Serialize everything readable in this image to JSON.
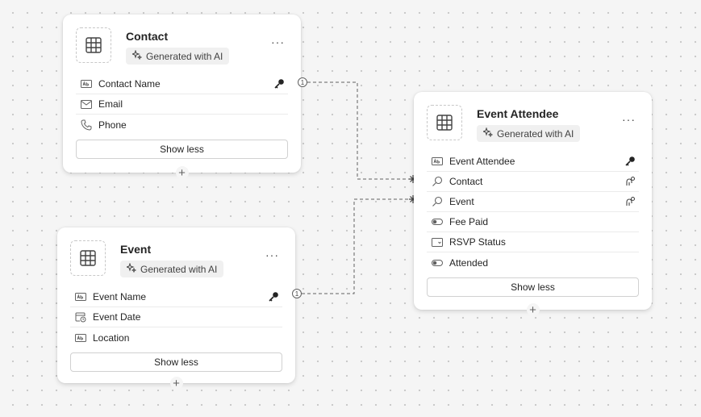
{
  "badge_text": "Generated with AI",
  "tables": [
    {
      "name": "Contact",
      "fields": [
        {
          "label": "Contact Name",
          "icon": "text-field-icon",
          "key": true
        },
        {
          "label": "Email",
          "icon": "email-icon"
        },
        {
          "label": "Phone",
          "icon": "phone-icon"
        }
      ],
      "show_less_label": "Show less"
    },
    {
      "name": "Event",
      "fields": [
        {
          "label": "Event Name",
          "icon": "text-field-icon",
          "key": true
        },
        {
          "label": "Event Date",
          "icon": "calendar-clock-icon"
        },
        {
          "label": "Location",
          "icon": "text-field-icon"
        }
      ],
      "show_less_label": "Show less"
    },
    {
      "name": "Event Attendee",
      "fields": [
        {
          "label": "Event Attendee",
          "icon": "text-field-icon",
          "key": true
        },
        {
          "label": "Contact",
          "icon": "lookup-icon",
          "relationship": true
        },
        {
          "label": "Event",
          "icon": "lookup-icon",
          "relationship": true
        },
        {
          "label": "Fee Paid",
          "icon": "toggle-icon"
        },
        {
          "label": "RSVP Status",
          "icon": "choice-icon"
        },
        {
          "label": "Attended",
          "icon": "toggle-icon"
        }
      ],
      "show_less_label": "Show less"
    }
  ],
  "relationships": [
    {
      "from": "Contact.Contact Name",
      "to": "Event Attendee.Contact",
      "from_cardinality": "1",
      "to_cardinality": "many"
    },
    {
      "from": "Event.Event Name",
      "to": "Event Attendee.Event",
      "from_cardinality": "1",
      "to_cardinality": "many"
    }
  ],
  "colors": {
    "canvas": "#f5f5f5",
    "card": "#ffffff",
    "connector": "#616161"
  }
}
